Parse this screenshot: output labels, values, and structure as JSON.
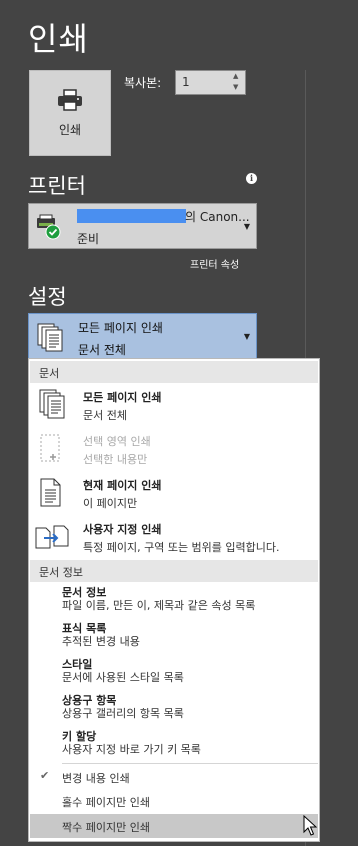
{
  "title": "인쇄",
  "print_button": {
    "label": "인쇄"
  },
  "copies": {
    "label": "복사본:",
    "value": "1"
  },
  "printer": {
    "heading": "프린터",
    "name_suffix": "의 Canon...",
    "status": "준비",
    "properties_link": "프린터 속성",
    "info_symbol": "i"
  },
  "settings": {
    "heading": "설정",
    "selected_title": "모든 페이지 인쇄",
    "selected_subtitle": "문서 전체"
  },
  "dropdown": {
    "group_document": "문서",
    "options": [
      {
        "title": "모든 페이지 인쇄",
        "desc": "문서 전체",
        "enabled": true
      },
      {
        "title": "선택 영역 인쇄",
        "desc": "선택한 내용만",
        "enabled": false
      },
      {
        "title": "현재 페이지 인쇄",
        "desc": "이 페이지만",
        "enabled": true
      },
      {
        "title": "사용자 지정 인쇄",
        "desc": "특정 페이지, 구역 또는 범위를 입력합니다.",
        "enabled": true
      }
    ],
    "group_doc_info": "문서 정보",
    "info_items": [
      {
        "title": "문서 정보",
        "desc": "파일 이름, 만든 이, 제목과 같은 속성 목록"
      },
      {
        "title": "표식 목록",
        "desc": "추적된 변경 내용"
      },
      {
        "title": "스타일",
        "desc": "문서에 사용된 스타일 목록"
      },
      {
        "title": "상용구 항목",
        "desc": "상용구 갤러리의 항목 목록"
      },
      {
        "title": "키 할당",
        "desc": "사용자 지정 바로 가기 키 목록"
      }
    ],
    "print_markup": {
      "label": "변경 내용 인쇄",
      "checked": true
    },
    "odd_pages": "홀수 페이지만 인쇄",
    "even_pages": "짝수 페이지만 인쇄"
  },
  "colors": {
    "background": "#444444",
    "selected_setting": "#a9c1e0",
    "redaction": "#4a8ff0",
    "hover_item": "#c8c8c8"
  }
}
